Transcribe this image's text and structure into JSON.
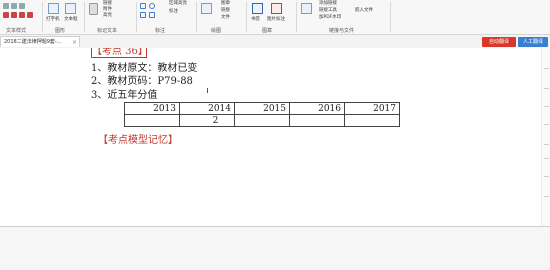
{
  "ribbon": {
    "groups": [
      {
        "label": "文本样式"
      },
      {
        "label": "图形"
      },
      {
        "label": "标记文本"
      },
      {
        "label": "标注"
      },
      {
        "label": "绘图"
      },
      {
        "label": "图章"
      },
      {
        "label": "链接与文件"
      }
    ],
    "items": {
      "typewriter": "打字机",
      "textbox": "文本框",
      "comment_link": "链接",
      "attach_file": "附件",
      "highlight": "高亮",
      "area_highlight": "区域高亮",
      "callout": "标注",
      "stamp": "图章",
      "link": "链接",
      "file": "文件",
      "bookmark": "书签",
      "image_annot": "图片标注",
      "pdf_watermark": "加PDF水印",
      "add_link": "添加链接",
      "link_tools": "链接工具",
      "embed_file": "嵌入文件"
    }
  },
  "tabbar": {
    "doc_tab_label": "2018二建法律押题9套-...",
    "auto_translate": "自动翻译",
    "human_translate": "人工翻译"
  },
  "document": {
    "heading": "【考点 36】",
    "lines": [
      "1、教材原文：教材已变",
      "2、教材页码：P79-88",
      "3、近五年分值"
    ],
    "table": {
      "headers": [
        "2013",
        "2014",
        "2015",
        "2016",
        "2017"
      ],
      "values": [
        "",
        "2",
        "",
        "",
        ""
      ]
    },
    "red_title": "【考点模型记忆】"
  },
  "colors": {
    "accent_red": "#c0392b",
    "translate_red": "#d9372b",
    "translate_blue": "#3a7fd1"
  }
}
